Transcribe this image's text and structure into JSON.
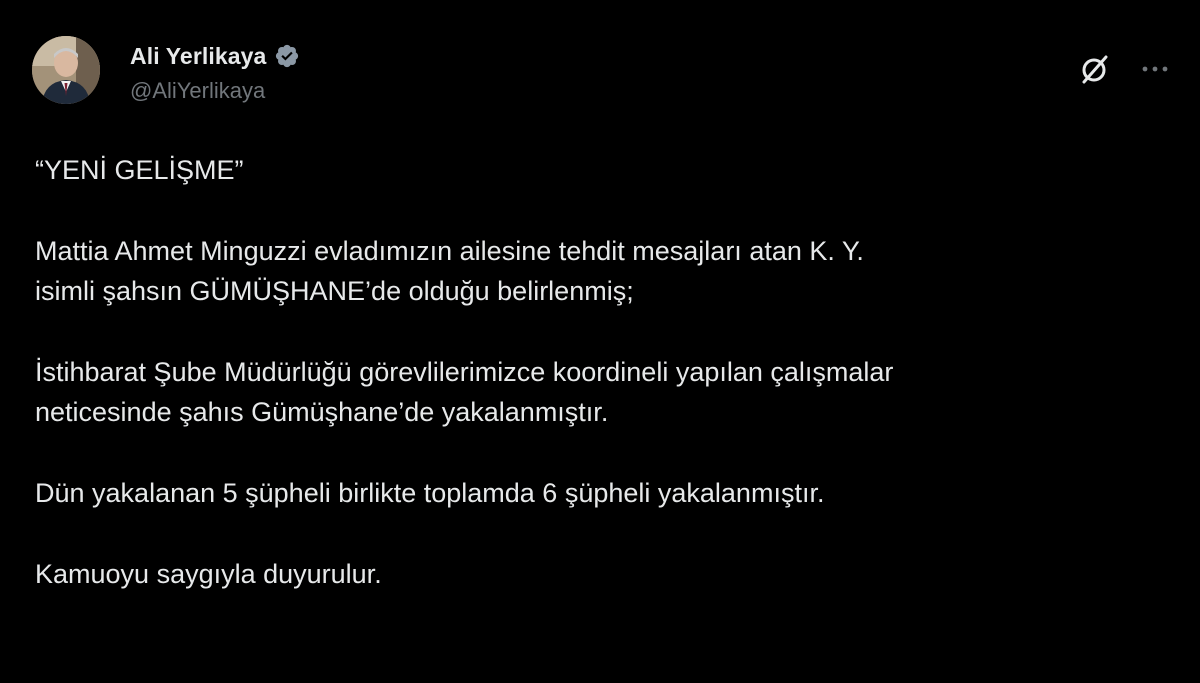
{
  "author": {
    "display_name": "Ali Yerlikaya",
    "handle": "@AliYerlikaya",
    "verified": true
  },
  "icons": {
    "verified_icon": "verified-badge-icon",
    "grok_icon": "grok-icon",
    "more_icon": "more-options-icon"
  },
  "colors": {
    "background": "#000000",
    "text": "#e7e9ea",
    "muted": "#71767b",
    "badge": "#8b98a5"
  },
  "tweet": {
    "paragraphs": [
      {
        "lines": [
          "“YENİ GELİŞME”"
        ]
      },
      {
        "lines": [
          "Mattia Ahmet Minguzzi evladımızın ailesine tehdit mesajları atan K. Y.",
          "isimli şahsın GÜMÜŞHANE’de olduğu belirlenmiş;"
        ]
      },
      {
        "lines": [
          "İstihbarat Şube Müdürlüğü görevlilerimizce koordineli yapılan çalışmalar",
          "neticesinde şahıs Gümüşhane’de yakalanmıştır."
        ]
      },
      {
        "lines": [
          "Dün yakalanan 5 şüpheli birlikte toplamda 6 şüpheli yakalanmıştır."
        ]
      },
      {
        "lines": [
          "Kamuoyu saygıyla duyurulur."
        ]
      }
    ]
  }
}
